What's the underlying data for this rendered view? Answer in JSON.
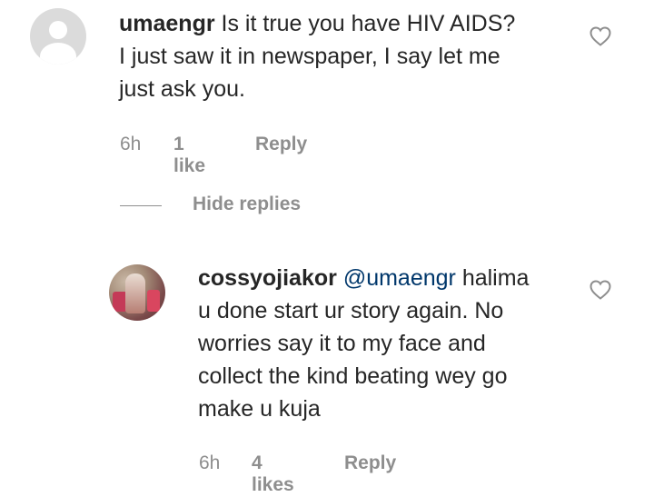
{
  "comments": [
    {
      "username": "umaengr",
      "text_line1": " Is it true you have HIV AIDS?",
      "text_line2": "I just saw it in newspaper, I say let me",
      "text_line3": "just ask you.",
      "time": "6h",
      "likes": "1 like",
      "reply": "Reply"
    }
  ],
  "thread": {
    "hide_replies": "Hide replies"
  },
  "replies": [
    {
      "username": "cossyojiakor",
      "mention": "@umaengr",
      "text_line1_rest": " halima",
      "text_line2": "u done start ur story again. No",
      "text_line3": "worries say it to my face and",
      "text_line4": "collect the kind beating wey go",
      "text_line5": "make u kuja",
      "time": "6h",
      "likes": "4 likes",
      "reply": "Reply"
    }
  ],
  "icons": {
    "like": "heart-outline-icon",
    "default_avatar": "default-avatar-icon"
  },
  "colors": {
    "text": "#262626",
    "muted": "#8e8e8e",
    "mention": "#00376b"
  }
}
